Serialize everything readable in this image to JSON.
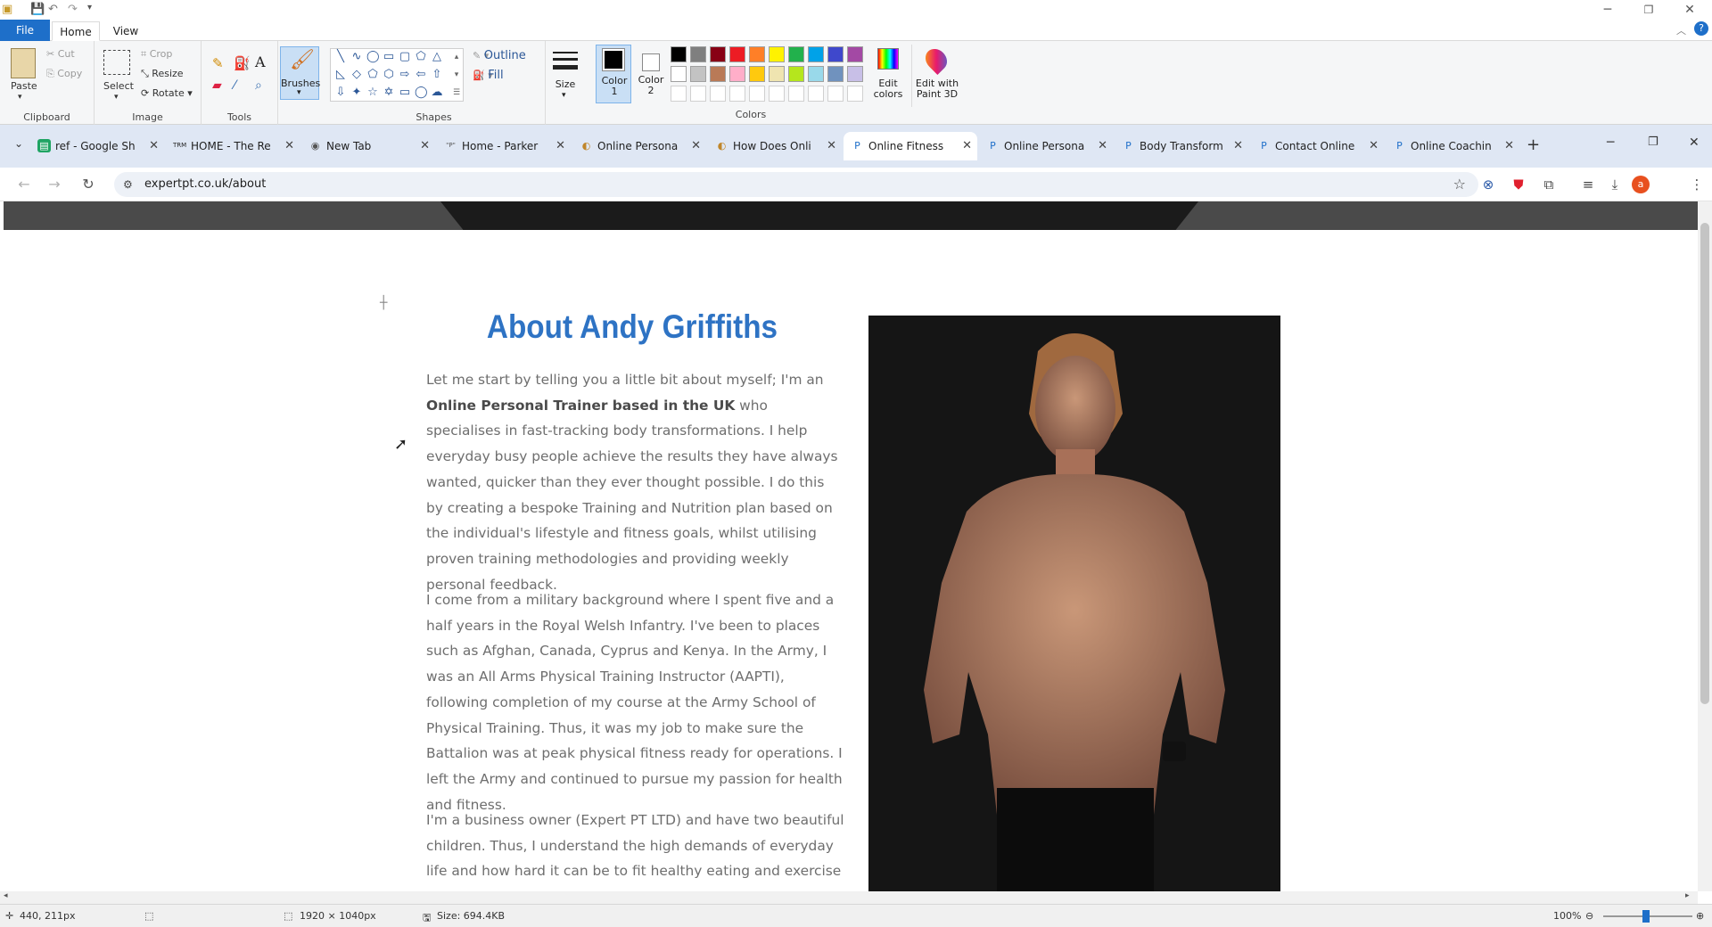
{
  "paint": {
    "quick_access": [
      "💾",
      "↶",
      "↷"
    ],
    "ribbon_tabs": {
      "file": "File",
      "home": "Home",
      "view": "View"
    },
    "clipboard": {
      "paste": "Paste",
      "cut": "Cut",
      "copy": "Copy",
      "label": "Clipboard"
    },
    "image": {
      "select": "Select",
      "crop": "Crop",
      "resize": "Resize",
      "rotate": "Rotate",
      "label": "Image"
    },
    "tools": {
      "label": "Tools"
    },
    "brushes": "Brushes",
    "shapes": {
      "outline": "Outline",
      "fill": "Fill",
      "label": "Shapes"
    },
    "size": "Size",
    "color1": "Color\n1",
    "color2": "Color\n2",
    "colors_label": "Colors",
    "edit_colors": "Edit\ncolors",
    "edit_paint3d": "Edit with\nPaint 3D",
    "palette_row1": [
      "#000000",
      "#7f7f7f",
      "#880015",
      "#ed1c24",
      "#ff7f27",
      "#fff200",
      "#22b14c",
      "#00a2e8",
      "#3f48cc",
      "#a349a4"
    ],
    "palette_row2": [
      "#ffffff",
      "#c3c3c3",
      "#b97a57",
      "#ffaec9",
      "#ffc90e",
      "#efe4b0",
      "#b5e61d",
      "#99d9ea",
      "#7092be",
      "#c8bfe7"
    ],
    "status": {
      "coords": "440, 211px",
      "dims": "1920 × 1040px",
      "size": "Size: 694.4KB",
      "zoom": "100%"
    }
  },
  "browser": {
    "tabs": [
      {
        "title": "ref - Google Sh",
        "icon": "sheets-icon"
      },
      {
        "title": "HOME - The Re",
        "icon": "trm-icon"
      },
      {
        "title": "New Tab",
        "icon": "chrome-icon"
      },
      {
        "title": "Home - Parker",
        "icon": "parker-icon"
      },
      {
        "title": "Online Persona",
        "icon": "site-icon"
      },
      {
        "title": "How Does Onli",
        "icon": "site-icon"
      },
      {
        "title": "Online Fitness",
        "icon": "expertpt-icon"
      },
      {
        "title": "Online Persona",
        "icon": "expertpt-icon"
      },
      {
        "title": "Body Transform",
        "icon": "expertpt-icon"
      },
      {
        "title": "Contact Online",
        "icon": "expertpt-icon"
      },
      {
        "title": "Online Coachin",
        "icon": "expertpt-icon"
      }
    ],
    "url": "expertpt.co.uk/about",
    "profile_initial": "a"
  },
  "page": {
    "heading": "About Andy Griffiths",
    "p1_a": "Let me start by telling you a little bit about myself; I'm an ",
    "p1_b": "Online Personal Trainer based in the UK",
    "p1_c": " who specialises in fast-tracking body transformations. I help everyday busy people achieve the results they have always wanted, quicker than they ever thought possible. I do this by creating a bespoke Training and Nutrition plan based on the individual's lifestyle and fitness goals, whilst utilising proven training methodologies and providing weekly personal feedback.",
    "p2": "I come from a military background where I spent five and a half years in the Royal Welsh Infantry. I've been to places such as Afghan, Canada, Cyprus and Kenya. In the Army, I was an All Arms Physical Training Instructor (AAPTI), following completion of my course at the Army School of Physical Training. Thus, it was my job to make sure the Battalion was at peak physical fitness ready for operations. I left the Army and continued to pursue my passion for health and fitness.",
    "p3": "I'm a business owner (Expert PT LTD) and have two beautiful children. Thus, I understand the high demands of everyday life and how hard it can be to fit healthy eating and exercise"
  }
}
